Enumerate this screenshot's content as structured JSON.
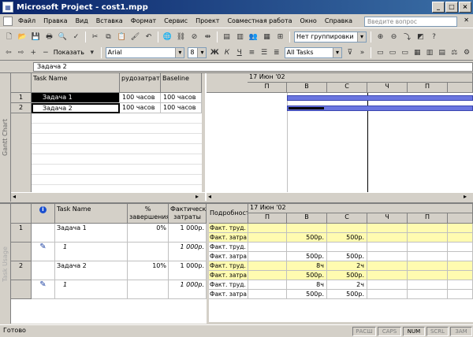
{
  "window": {
    "title": "Microsoft Project - cost1.mpp",
    "min": "_",
    "max": "□",
    "close": "×"
  },
  "menu": [
    "Файл",
    "Правка",
    "Вид",
    "Вставка",
    "Формат",
    "Сервис",
    "Проект",
    "Совместная работа",
    "Окно",
    "Справка"
  ],
  "ask_placeholder": "Введите вопрос",
  "toolbar1": {
    "grouping": "Нет группировки"
  },
  "toolbar2": {
    "show_label": "Показать",
    "font": "Arial",
    "size": "8",
    "bold": "Ж",
    "italic": "К",
    "underline": "Ч",
    "filter": "All Tasks"
  },
  "entry": {
    "value": "Задача 2"
  },
  "gantt": {
    "side_label": "Gantt Chart",
    "headers": [
      "Task Name",
      "рудозатрат",
      "Baseline"
    ],
    "rows": [
      {
        "id": "1",
        "name": "Задача 1",
        "work": "100 часов",
        "baseline": "100 часов"
      },
      {
        "id": "2",
        "name": "Задача 2",
        "work": "100 часов",
        "baseline": "100 часов"
      }
    ],
    "timescale": {
      "top": "17 Июн '02",
      "days": [
        "П",
        "В",
        "С",
        "Ч",
        "П"
      ]
    }
  },
  "usage": {
    "side_label": "Task Usage",
    "headers": {
      "info": "i",
      "name": "Task Name",
      "pct": "% завершения",
      "cost": "Фактические затраты",
      "details": "Подробности"
    },
    "tasks": [
      {
        "id": "1",
        "name": "Задача 1",
        "pct": "0%",
        "cost": "1 000р.",
        "res": "1",
        "rcost": "1 000р."
      },
      {
        "id": "2",
        "name": "Задача 2",
        "pct": "10%",
        "cost": "1 000р.",
        "res": "1",
        "rcost": "1 000р."
      }
    ],
    "timescale": {
      "top": "17 Июн '02",
      "days": [
        "П",
        "В",
        "С",
        "Ч",
        "П"
      ]
    },
    "detail_rows": [
      {
        "label": "Факт. труд.",
        "vals": [
          "",
          "",
          "",
          "",
          ""
        ],
        "hl": true
      },
      {
        "label": "Факт. затра",
        "vals": [
          "",
          "500р.",
          "500р.",
          "",
          ""
        ],
        "hl": true
      },
      {
        "label": "Факт. труд.",
        "vals": [
          "",
          "",
          "",
          "",
          ""
        ],
        "hl": false
      },
      {
        "label": "Факт. затра",
        "vals": [
          "",
          "500р.",
          "500р.",
          "",
          ""
        ],
        "hl": false
      },
      {
        "label": "Факт. труд.",
        "vals": [
          "",
          "8ч",
          "2ч",
          "",
          ""
        ],
        "hl": true
      },
      {
        "label": "Факт. затра",
        "vals": [
          "",
          "500р.",
          "500р.",
          "",
          ""
        ],
        "hl": true
      },
      {
        "label": "Факт. труд.",
        "vals": [
          "",
          "8ч",
          "2ч",
          "",
          ""
        ],
        "hl": false
      },
      {
        "label": "Факт. затра",
        "vals": [
          "",
          "500р.",
          "500р.",
          "",
          ""
        ],
        "hl": false
      }
    ]
  },
  "status": {
    "ready": "Готово",
    "indicators": [
      "РАСШ",
      "CAPS",
      "NUM",
      "SCRL",
      "ЗАМ"
    ]
  }
}
